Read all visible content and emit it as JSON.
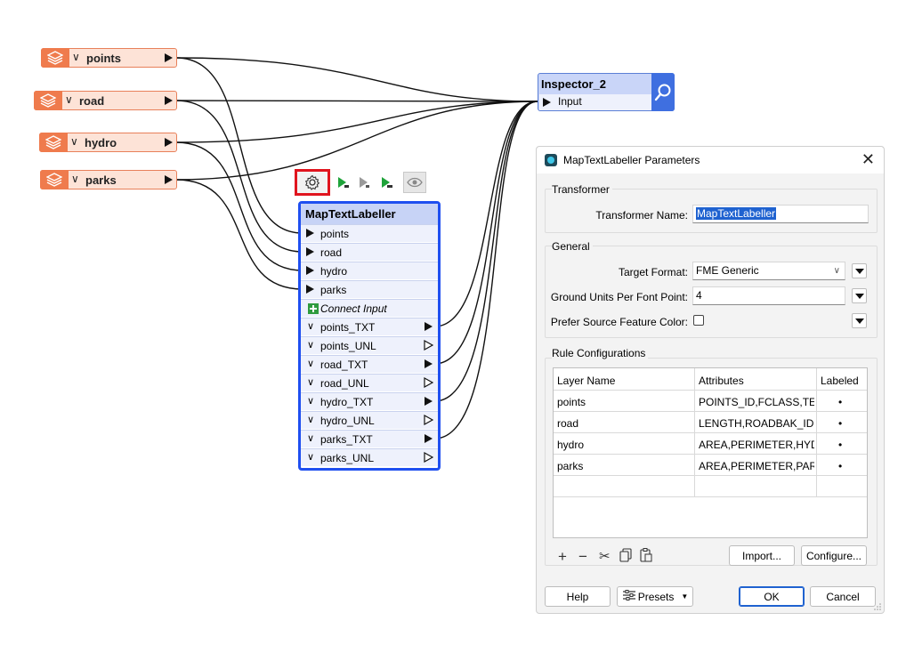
{
  "canvas": {
    "readers": [
      {
        "label": "points"
      },
      {
        "label": "road"
      },
      {
        "label": "hydro"
      },
      {
        "label": "parks"
      }
    ],
    "inspector": {
      "title": "Inspector_2",
      "input_port": "Input"
    },
    "transformer": {
      "title": "MapTextLabeller",
      "input_ports": [
        "points",
        "road",
        "hydro",
        "parks"
      ],
      "connect_input": "Connect Input",
      "output_ports": [
        "points_TXT",
        "points_UNL",
        "road_TXT",
        "road_UNL",
        "hydro_TXT",
        "hydro_UNL",
        "parks_TXT",
        "parks_UNL"
      ]
    }
  },
  "dialog": {
    "title": "MapTextLabeller Parameters",
    "transformer_group": {
      "label": "Transformer",
      "name_label": "Transformer Name:",
      "name_value": "MapTextLabeller"
    },
    "general_group": {
      "label": "General",
      "target_format_label": "Target Format:",
      "target_format_value": "FME Generic",
      "ground_units_label": "Ground Units Per Font Point:",
      "ground_units_value": "4",
      "prefer_color_label": "Prefer Source Feature Color:"
    },
    "rules_group": {
      "label": "Rule Configurations",
      "columns": [
        "Layer Name",
        "Attributes",
        "Labeled"
      ],
      "rows": [
        {
          "layer": "points",
          "attributes": "POINTS_ID,FCLASS,TE...",
          "labeled": "•"
        },
        {
          "layer": "road",
          "attributes": "LENGTH,ROADBAK_ID,...",
          "labeled": "•"
        },
        {
          "layer": "hydro",
          "attributes": "AREA,PERIMETER,HYD...",
          "labeled": "•"
        },
        {
          "layer": "parks",
          "attributes": "AREA,PERIMETER,PAR...",
          "labeled": "•"
        }
      ],
      "import_label": "Import...",
      "configure_label": "Configure..."
    },
    "buttons": {
      "help": "Help",
      "presets": "Presets",
      "ok": "OK",
      "cancel": "Cancel"
    }
  }
}
